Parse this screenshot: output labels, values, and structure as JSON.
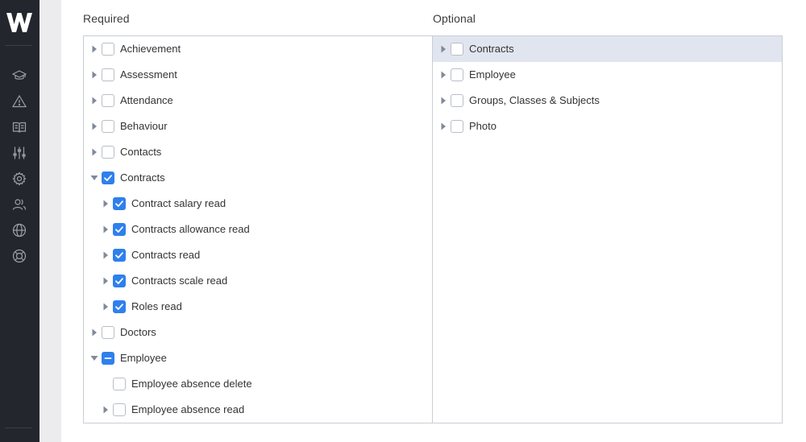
{
  "columns": {
    "required_label": "Required",
    "optional_label": "Optional"
  },
  "sidebar": {
    "logo_letter": "W",
    "icons": [
      "graduation-cap-icon",
      "warning-icon",
      "book-icon",
      "sliders-icon",
      "gear-icon",
      "users-icon",
      "globe-icon",
      "lifebuoy-icon"
    ]
  },
  "required": [
    {
      "label": "Achievement",
      "level": 0,
      "expander": "collapsed",
      "state": "unchecked"
    },
    {
      "label": "Assessment",
      "level": 0,
      "expander": "collapsed",
      "state": "unchecked"
    },
    {
      "label": "Attendance",
      "level": 0,
      "expander": "collapsed",
      "state": "unchecked"
    },
    {
      "label": "Behaviour",
      "level": 0,
      "expander": "collapsed",
      "state": "unchecked"
    },
    {
      "label": "Contacts",
      "level": 0,
      "expander": "collapsed",
      "state": "unchecked"
    },
    {
      "label": "Contracts",
      "level": 0,
      "expander": "expanded",
      "state": "checked"
    },
    {
      "label": "Contract salary read",
      "level": 1,
      "expander": "collapsed",
      "state": "checked"
    },
    {
      "label": "Contracts allowance read",
      "level": 1,
      "expander": "collapsed",
      "state": "checked"
    },
    {
      "label": "Contracts read",
      "level": 1,
      "expander": "collapsed",
      "state": "checked"
    },
    {
      "label": "Contracts scale read",
      "level": 1,
      "expander": "collapsed",
      "state": "checked"
    },
    {
      "label": "Roles read",
      "level": 1,
      "expander": "collapsed",
      "state": "checked"
    },
    {
      "label": "Doctors",
      "level": 0,
      "expander": "collapsed",
      "state": "unchecked"
    },
    {
      "label": "Employee",
      "level": 0,
      "expander": "expanded",
      "state": "partial"
    },
    {
      "label": "Employee absence delete",
      "level": 1,
      "expander": "none",
      "state": "unchecked"
    },
    {
      "label": "Employee absence read",
      "level": 1,
      "expander": "collapsed",
      "state": "unchecked"
    }
  ],
  "optional": [
    {
      "label": "Contracts",
      "level": 0,
      "expander": "collapsed",
      "state": "unchecked",
      "highlighted": true
    },
    {
      "label": "Employee",
      "level": 0,
      "expander": "collapsed",
      "state": "unchecked"
    },
    {
      "label": "Groups, Classes & Subjects",
      "level": 0,
      "expander": "collapsed",
      "state": "unchecked"
    },
    {
      "label": "Photo",
      "level": 0,
      "expander": "collapsed",
      "state": "unchecked"
    }
  ],
  "colors": {
    "sidebar": "#23262d",
    "accent": "#2f80ed",
    "highlight_row": "#e1e5ef",
    "caret": "#7f8a99"
  }
}
